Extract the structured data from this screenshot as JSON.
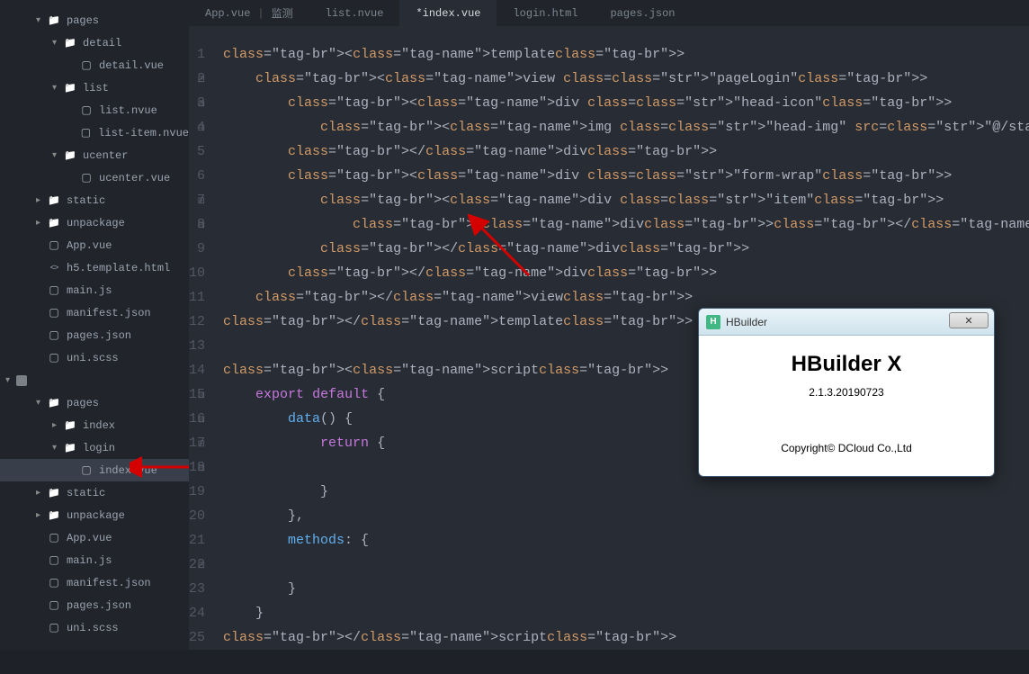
{
  "sidebar": {
    "items": [
      {
        "ind": 2,
        "chev": "down",
        "icon": "folder",
        "label": "pages"
      },
      {
        "ind": 3,
        "chev": "down",
        "icon": "folder",
        "label": "detail"
      },
      {
        "ind": 4,
        "chev": "",
        "icon": "file",
        "label": "detail.vue"
      },
      {
        "ind": 3,
        "chev": "down",
        "icon": "folder",
        "label": "list"
      },
      {
        "ind": 4,
        "chev": "",
        "icon": "file",
        "label": "list.nvue"
      },
      {
        "ind": 4,
        "chev": "",
        "icon": "file",
        "label": "list-item.nvue"
      },
      {
        "ind": 3,
        "chev": "down",
        "icon": "folder",
        "label": "ucenter"
      },
      {
        "ind": 4,
        "chev": "",
        "icon": "file",
        "label": "ucenter.vue"
      },
      {
        "ind": 2,
        "chev": "right",
        "icon": "folder",
        "label": "static"
      },
      {
        "ind": 2,
        "chev": "right",
        "icon": "folder",
        "label": "unpackage"
      },
      {
        "ind": 2,
        "chev": "",
        "icon": "file",
        "label": "App.vue"
      },
      {
        "ind": 2,
        "chev": "",
        "icon": "code",
        "label": "h5.template.html"
      },
      {
        "ind": 2,
        "chev": "",
        "icon": "file",
        "label": "main.js"
      },
      {
        "ind": 2,
        "chev": "",
        "icon": "file",
        "label": "manifest.json"
      },
      {
        "ind": 2,
        "chev": "",
        "icon": "file",
        "label": "pages.json"
      },
      {
        "ind": 2,
        "chev": "",
        "icon": "file",
        "label": "uni.scss"
      }
    ],
    "proj": "",
    "items2": [
      {
        "ind": 2,
        "chev": "down",
        "icon": "folder",
        "label": "pages"
      },
      {
        "ind": 3,
        "chev": "right",
        "icon": "folder",
        "label": "index"
      },
      {
        "ind": 3,
        "chev": "down",
        "icon": "folder",
        "label": "login"
      },
      {
        "ind": 4,
        "chev": "",
        "icon": "file",
        "label": "index.vue",
        "active": true
      },
      {
        "ind": 2,
        "chev": "right",
        "icon": "folder",
        "label": "static"
      },
      {
        "ind": 2,
        "chev": "right",
        "icon": "folder",
        "label": "unpackage"
      },
      {
        "ind": 2,
        "chev": "",
        "icon": "file",
        "label": "App.vue"
      },
      {
        "ind": 2,
        "chev": "",
        "icon": "file",
        "label": "main.js"
      },
      {
        "ind": 2,
        "chev": "",
        "icon": "file",
        "label": "manifest.json"
      },
      {
        "ind": 2,
        "chev": "",
        "icon": "file",
        "label": "pages.json"
      },
      {
        "ind": 2,
        "chev": "",
        "icon": "file",
        "label": "uni.scss"
      }
    ]
  },
  "tabs": {
    "t0a": "App.vue",
    "t0b": "监测",
    "t1": "list.nvue",
    "t2": "*index.vue",
    "t3": "login.html",
    "t4": "pages.json"
  },
  "code": {
    "lines": [
      "<template>",
      "    <view class=\"pageLogin\">",
      "        <div class=\"head-icon\">",
      "            <img class=\"head-img\" src=\"@/static/head-icon.png\">",
      "        </div>",
      "        <div class=\"form-wrap\">",
      "            <div class=\"item\">",
      "                <div></d>",
      "            </div>",
      "        </div>",
      "    </view>",
      "</template>",
      "",
      "<script>",
      "    export default {",
      "        data() {",
      "            return {",
      "                ",
      "            }",
      "        },",
      "        methods: {",
      "            ",
      "        }",
      "    }",
      "</script>"
    ],
    "folds": {
      "1": "⊟",
      "2": "⊟",
      "3": "⊟",
      "6": "⊟",
      "7": "⊟",
      "14": "⊟",
      "15": "⊟",
      "16": "⊟",
      "17": "⊟",
      "21": "⊟"
    }
  },
  "dialog": {
    "title": "HBuilder",
    "h1": "HBuilder X",
    "ver": "2.1.3.20190723",
    "copy": "Copyright© DCloud Co.,Ltd",
    "close": "✕"
  }
}
